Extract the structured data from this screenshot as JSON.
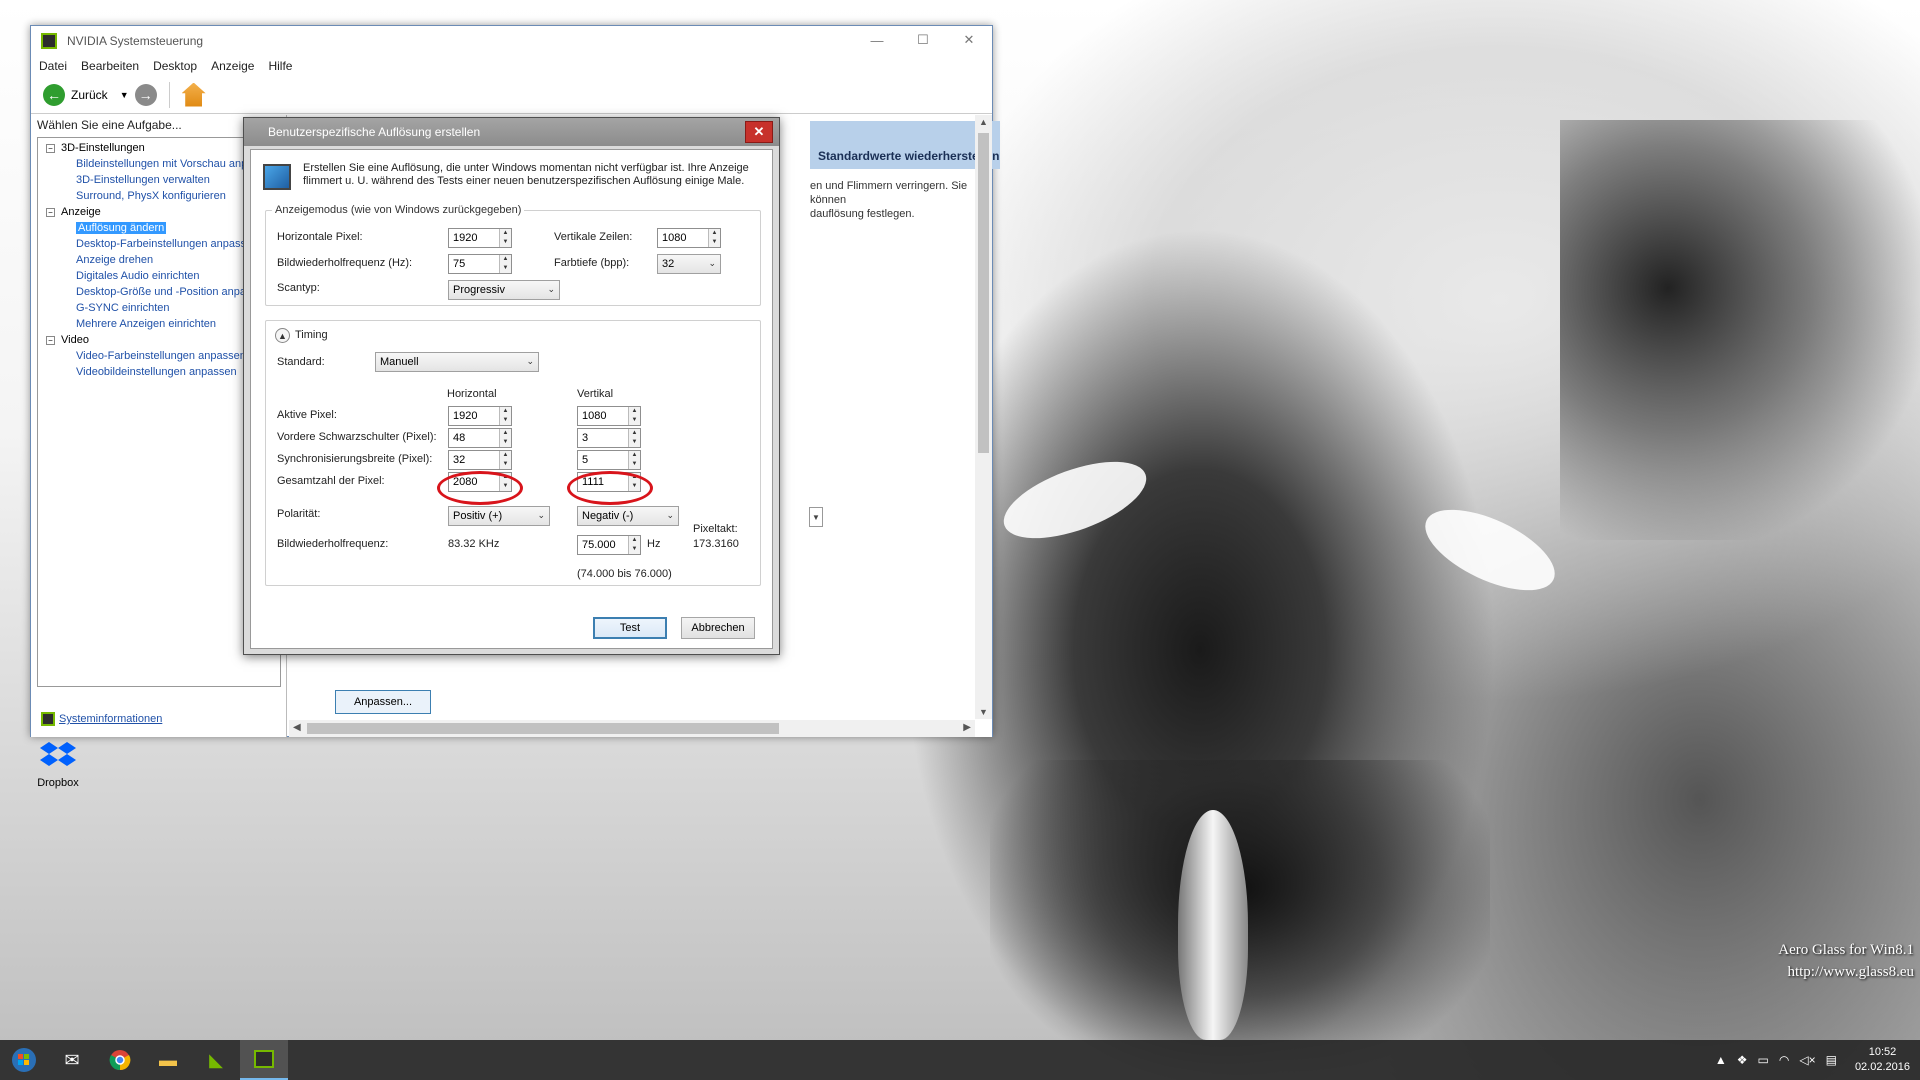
{
  "window": {
    "title": "NVIDIA Systemsteuerung",
    "menu": [
      "Datei",
      "Bearbeiten",
      "Desktop",
      "Anzeige",
      "Hilfe"
    ],
    "back_label": "Zurück",
    "task_label": "Wählen Sie eine Aufgabe...",
    "tree": [
      {
        "type": "cat",
        "label": "3D-Einstellungen"
      },
      {
        "type": "item",
        "label": "Bildeinstellungen mit Vorschau anp"
      },
      {
        "type": "item",
        "label": "3D-Einstellungen verwalten"
      },
      {
        "type": "item",
        "label": "Surround, PhysX konfigurieren"
      },
      {
        "type": "cat",
        "label": "Anzeige"
      },
      {
        "type": "item",
        "label": "Auflösung ändern",
        "selected": true
      },
      {
        "type": "item",
        "label": "Desktop-Farbeinstellungen anpass"
      },
      {
        "type": "item",
        "label": "Anzeige drehen"
      },
      {
        "type": "item",
        "label": "Digitales Audio einrichten"
      },
      {
        "type": "item",
        "label": "Desktop-Größe und -Position anpa"
      },
      {
        "type": "item",
        "label": "G-SYNC einrichten"
      },
      {
        "type": "item",
        "label": "Mehrere Anzeigen einrichten"
      },
      {
        "type": "cat",
        "label": "Video"
      },
      {
        "type": "item",
        "label": "Video-Farbeinstellungen anpassen"
      },
      {
        "type": "item",
        "label": "Videobildeinstellungen anpassen"
      }
    ],
    "sysinfo_label": "Systeminformationen",
    "restore_label": "Standardwerte wiederherstellen",
    "bg_text_1": "en und Flimmern verringern. Sie können",
    "bg_text_2": "dauflösung festlegen.",
    "anpassen_label": "Anpassen..."
  },
  "dialog": {
    "title": "Benutzerspezifische Auflösung erstellen",
    "intro": "Erstellen Sie eine Auflösung, die unter Windows momentan nicht verfügbar ist. Ihre Anzeige flimmert u. U. während des Tests einer neuen benutzerspezifischen Auflösung einige Male.",
    "mode_group": "Anzeigemodus (wie von Windows zurückgegeben)",
    "h_pixels_label": "Horizontale Pixel:",
    "h_pixels": "1920",
    "v_lines_label": "Vertikale Zeilen:",
    "v_lines": "1080",
    "refresh_label": "Bildwiederholfrequenz (Hz):",
    "refresh": "75",
    "depth_label": "Farbtiefe (bpp):",
    "depth": "32",
    "scan_label": "Scantyp:",
    "scan": "Progressiv",
    "timing_label": "Timing",
    "standard_label": "Standard:",
    "standard": "Manuell",
    "col_h": "Horizontal",
    "col_v": "Vertikal",
    "rows": [
      {
        "label": "Aktive Pixel:",
        "h": "1920",
        "v": "1080"
      },
      {
        "label": "Vordere Schwarzschulter (Pixel):",
        "h": "48",
        "v": "3"
      },
      {
        "label": "Synchronisierungsbreite (Pixel):",
        "h": "32",
        "v": "5"
      },
      {
        "label": "Gesamtzahl der Pixel:",
        "h": "2080",
        "v": "1111"
      }
    ],
    "polarity_label": "Polarität:",
    "polarity_h": "Positiv (+)",
    "polarity_v": "Negativ (-)",
    "freq_label": "Bildwiederholfrequenz:",
    "freq_h": "83.32 KHz",
    "freq_v": "75.000",
    "freq_unit": "Hz",
    "freq_range": "(74.000 bis 76.000)",
    "pixclk_label": "Pixeltakt:",
    "pixclk": "173.3160",
    "test_label": "Test",
    "cancel_label": "Abbrechen"
  },
  "desktop": {
    "dropbox_label": "Dropbox",
    "watermark_1": "Aero Glass for Win8.1",
    "watermark_2": "http://www.glass8.eu"
  },
  "taskbar": {
    "time": "10:52",
    "date": "02.02.2016"
  },
  "colors": {
    "nvidia_green": "#76b900",
    "highlight": "#d8141b",
    "selection": "#3399ff"
  }
}
